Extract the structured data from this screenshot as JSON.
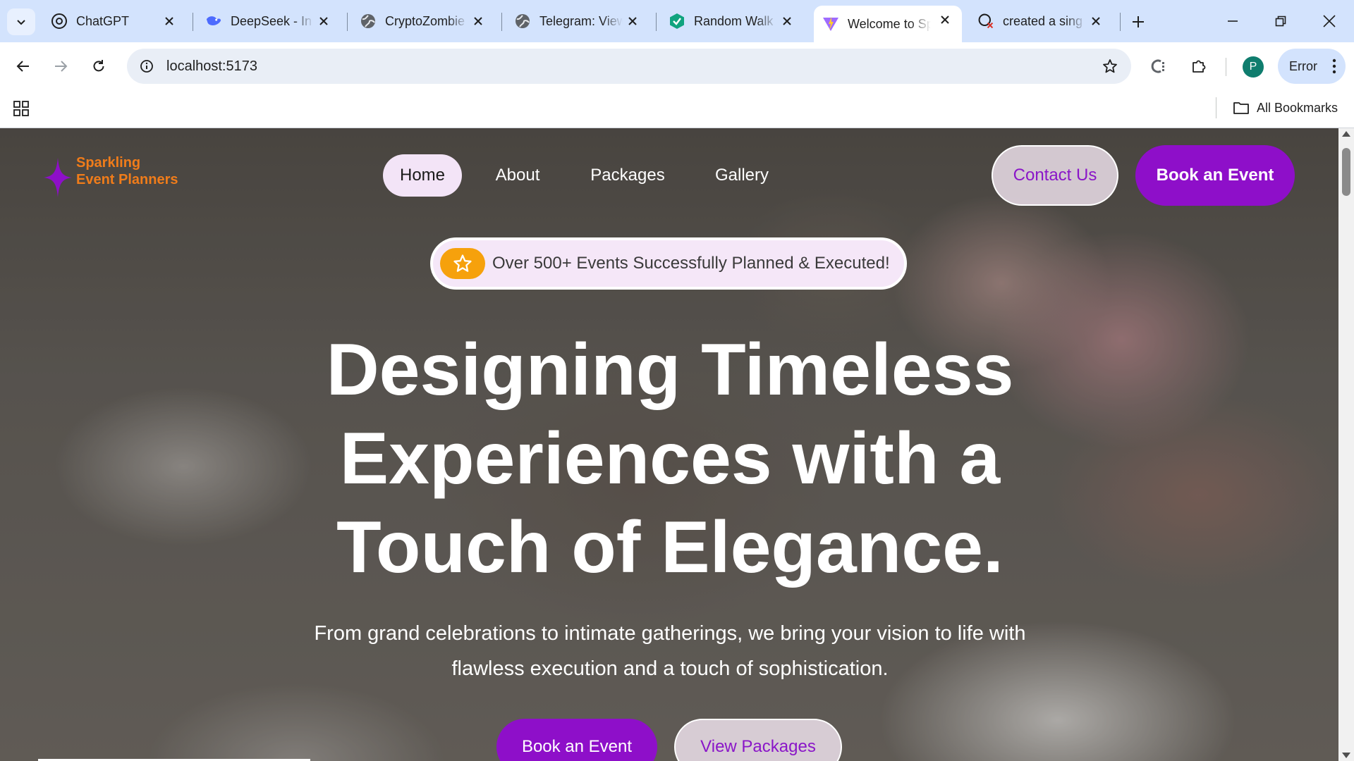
{
  "browser": {
    "tabs": [
      {
        "title": "ChatGPT",
        "icon": "chatgpt-icon"
      },
      {
        "title": "DeepSeek - In",
        "icon": "deepseek-icon"
      },
      {
        "title": "CryptoZombie",
        "icon": "globe-icon"
      },
      {
        "title": "Telegram: View",
        "icon": "globe-icon"
      },
      {
        "title": "Random Walk",
        "icon": "random-walk-icon"
      },
      {
        "title": "Welcome to Sp",
        "icon": "vite-icon",
        "active": true
      },
      {
        "title": "created a sing",
        "icon": "github-error-icon"
      }
    ],
    "url": "localhost:5173",
    "profile_initial": "P",
    "error_label": "Error",
    "all_bookmarks_label": "All Bookmarks"
  },
  "site": {
    "logo": {
      "line1": "Sparkling",
      "line2": "Event Planners"
    },
    "nav": [
      {
        "label": "Home",
        "active": true
      },
      {
        "label": "About"
      },
      {
        "label": "Packages"
      },
      {
        "label": "Gallery"
      }
    ],
    "contact_label": "Contact Us",
    "book_label": "Book an Event",
    "badge_text": "Over 500+ Events Successfully Planned & Executed!",
    "headline": {
      "line1": "Designing Timeless",
      "line2": "Experiences with a",
      "line3": "Touch of Elegance."
    },
    "subheading": {
      "line1": "From grand celebrations to intimate gatherings, we bring your vision to life with",
      "line2": "flawless execution and a touch of sophistication."
    },
    "cta_book": "Book an Event",
    "cta_packages": "View Packages"
  },
  "colors": {
    "accent_purple": "#8e0fc9",
    "logo_orange": "#f07c1a",
    "badge_star": "#f6a10c",
    "tabstrip": "#d3e3fd"
  }
}
